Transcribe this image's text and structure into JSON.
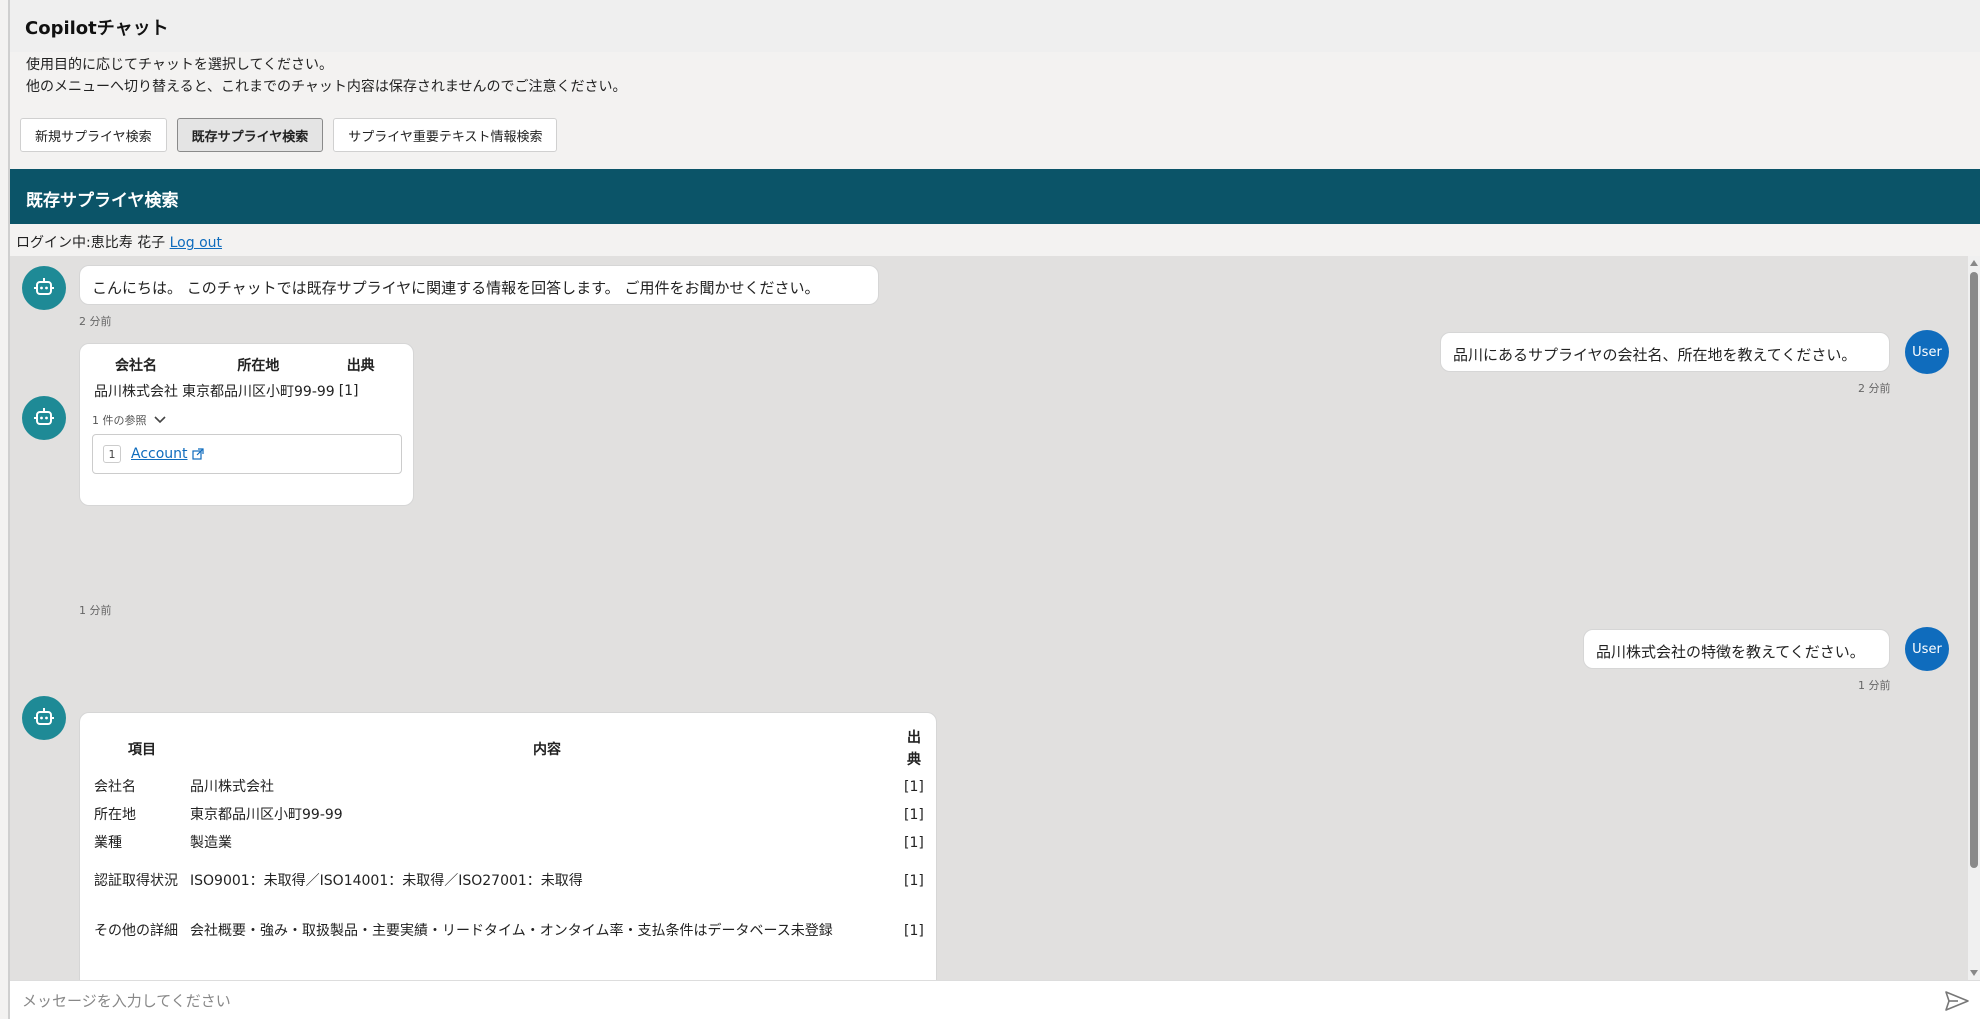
{
  "app": {
    "title": "Copilotチャット"
  },
  "intro": {
    "line1": "使用目的に応じてチャットを選択してください。",
    "line2": "他のメニューへ切り替えると、これまでのチャット内容は保存されませんのでご注意ください。"
  },
  "modes": [
    {
      "label": "新規サプライヤ検索",
      "active": false
    },
    {
      "label": "既存サプライヤ検索",
      "active": true
    },
    {
      "label": "サプライヤ重要テキスト情報検索",
      "active": false
    }
  ],
  "section": {
    "title": "既存サプライヤ検索"
  },
  "login": {
    "text": "ログイン中:恵比寿 花子",
    "logout_label": "Log out"
  },
  "messages": {
    "m1": {
      "text": "こんにちは。 このチャットでは既存サプライヤに関連する情報を回答します。 ご用件をお聞かせください。",
      "time": "2 分前"
    },
    "m2": {
      "text": "品川にあるサプライヤの会社名、所在地を教えてください。",
      "time": "2 分前",
      "avatar": "User"
    },
    "m3": {
      "headers": [
        "会社名",
        "所在地",
        "出典"
      ],
      "row": [
        "品川株式会社",
        "東京都品川区小町99-99",
        "[1]"
      ],
      "refs_label": "1 件の参照",
      "ref_num": "1",
      "ref_link": "Account",
      "time": "1 分前"
    },
    "m4": {
      "text": "品川株式会社の特徴を教えてください。",
      "time": "1 分前",
      "avatar": "User"
    },
    "m5": {
      "headers": [
        "項目",
        "内容",
        "出典"
      ],
      "rows": [
        [
          "会社名",
          "品川株式会社",
          "[1]"
        ],
        [
          "所在地",
          "東京都品川区小町99-99",
          "[1]"
        ],
        [
          "業種",
          "製造業",
          "[1]"
        ],
        [
          "認証取得状況",
          "ISO9001：未取得／ISO14001：未取得／ISO27001：未取得",
          "[1]"
        ],
        [
          "その他の詳細",
          "会社概要・強み・取扱製品・主要実績・リードタイム・オンタイム率・支払条件はデータベース未登録",
          "[1]"
        ]
      ]
    }
  },
  "input": {
    "placeholder": "メッセージを入力してください"
  },
  "colors": {
    "header_bg": "#0b5468",
    "bot_avatar": "#1e8a96",
    "user_avatar": "#0f6cbd",
    "chat_bg": "#e1e0df"
  },
  "icons": {
    "bot": "bot-icon",
    "send": "send-icon",
    "external": "external-link-icon",
    "chevron": "chevron-down-icon"
  }
}
